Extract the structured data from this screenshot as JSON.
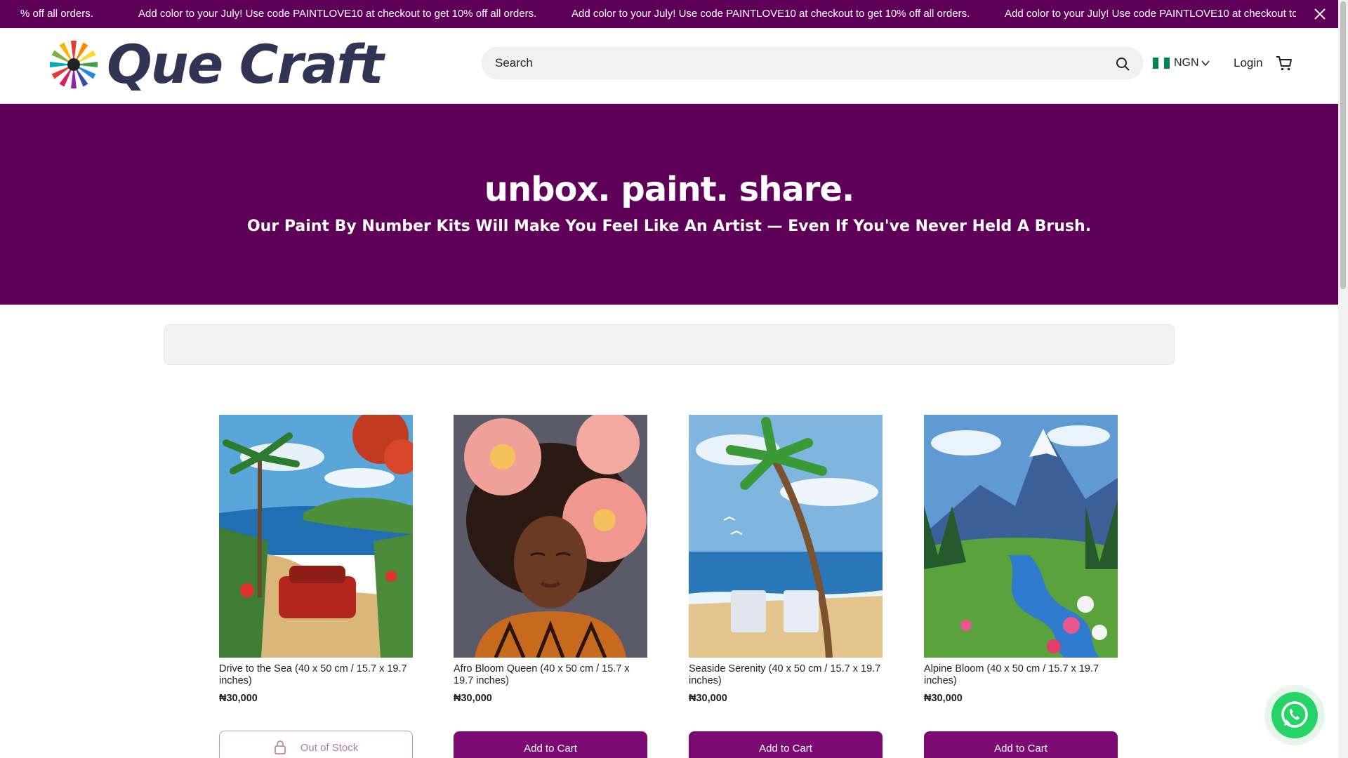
{
  "announcement": {
    "message": "Add color to your July! Use code PAINTLOVE10 at checkout to get 10% off all orders.",
    "fragment_left": "% off all orders."
  },
  "header": {
    "brand": "Que Craft",
    "search_placeholder": "Search",
    "currency": "NGN",
    "login": "Login"
  },
  "hero": {
    "headline": "unbox. paint. share.",
    "subheadline": "Our Paint By Number Kits Will Make You Feel Like An Artist — Even If You've Never Held A Brush."
  },
  "products": [
    {
      "title": "Drive to the Sea (40 x 50 cm / 15.7 x 19.7 inches)",
      "price": "₦30,000",
      "button": "Out of Stock",
      "in_stock": false
    },
    {
      "title": "Afro Bloom Queen (40 x 50 cm / 15.7 x 19.7 inches)",
      "price": "₦30,000",
      "button": "Add to Cart",
      "in_stock": true
    },
    {
      "title": "Seaside Serenity (40 x 50 cm / 15.7 x 19.7 inches)",
      "price": "₦30,000",
      "button": "Add to Cart",
      "in_stock": true
    },
    {
      "title": "Alpine Bloom (40 x 50 cm / 15.7 x 19.7 inches)",
      "price": "₦30,000",
      "button": "Add to Cart",
      "in_stock": true
    }
  ],
  "colors": {
    "brand_purple": "#5f0058",
    "button_purple": "#7b0a73",
    "logo_text": "#2f3552",
    "whatsapp_green": "#25d366"
  },
  "icons": {
    "close": "close-icon",
    "search": "search-icon",
    "flag": "nigeria-flag-icon",
    "dropdown": "chevron-down-icon",
    "cart": "cart-icon",
    "lock": "lock-icon",
    "whatsapp": "whatsapp-icon"
  }
}
